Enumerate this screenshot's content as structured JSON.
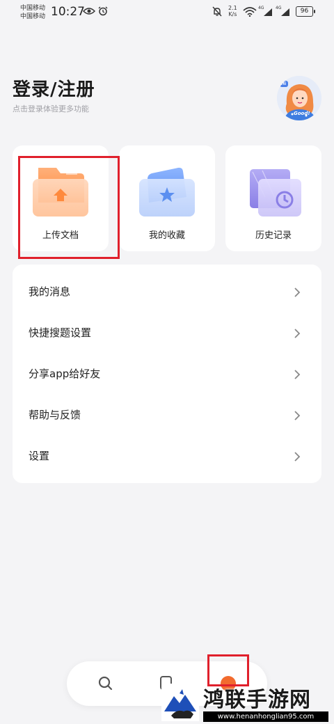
{
  "status_bar": {
    "carrier_1": "中国移动",
    "carrier_2": "中国移动",
    "time": "10:27",
    "net_speed_value": "2.1",
    "net_speed_unit": "K/s",
    "signal_1": "4G",
    "signal_2": "4G",
    "battery": "96",
    "icons": [
      "eye-icon",
      "alarm-icon",
      "mute-bell-icon",
      "wifi-icon",
      "signal-icon",
      "battery-icon"
    ]
  },
  "header": {
    "title": "登录/注册",
    "subtitle": "点击登录体验更多功能",
    "avatar_text": "Good!",
    "avatar_badge": "Hi"
  },
  "quick_actions": [
    {
      "label": "上传文档",
      "icon": "upload-folder-icon",
      "color": "#ff8a3d"
    },
    {
      "label": "我的收藏",
      "icon": "favorites-folder-icon",
      "color": "#5b8ff0"
    },
    {
      "label": "历史记录",
      "icon": "history-icon",
      "color": "#8a7fe6"
    }
  ],
  "menu": [
    {
      "label": "我的消息"
    },
    {
      "label": "快捷搜题设置"
    },
    {
      "label": "分享app给好友"
    },
    {
      "label": "帮助与反馈"
    },
    {
      "label": "设置"
    }
  ],
  "bottom_nav": {
    "items": [
      "search-icon",
      "docs-icon",
      "profile-icon"
    ],
    "active_color": "#f26b2e"
  },
  "watermark": {
    "title": "鸿联手游网",
    "url": "www.henanhonglian95.com"
  },
  "colors": {
    "highlight": "#e0202c",
    "background": "#f4f4f6",
    "card": "#ffffff"
  }
}
